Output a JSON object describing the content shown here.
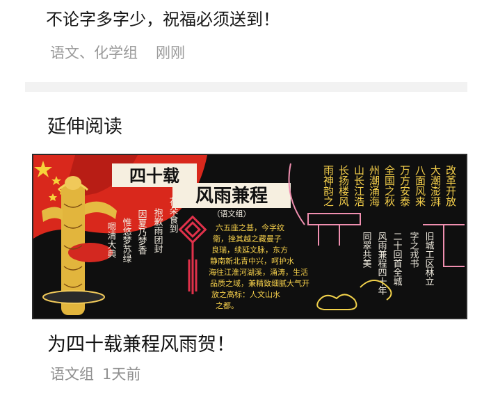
{
  "top_card": {
    "title": "不论字多字少，祝福必须送到！",
    "author": "语文、化学组",
    "time": "刚刚"
  },
  "section": {
    "heading": "延伸阅读"
  },
  "article": {
    "title": "为四十载兼程风雨贺！",
    "author": "语文组",
    "time": "1天前",
    "board": {
      "title_line1": "四十载",
      "title_line2": "风雨兼程",
      "group_label": "（语文组）",
      "poem_right": [
        "改革开放",
        "大潮澎湃",
        "八面风来",
        "万方安泰",
        "全国之秋",
        "州潮涌海",
        "山长江浩",
        "长扬楼风",
        "雨神韵之"
      ],
      "colors": {
        "board": "#101010",
        "flag_red": "#d9281c",
        "chalk_yellow": "#f2d24b",
        "chalk_pink": "#f08fb0",
        "chalk_white": "#f1ece0"
      }
    }
  }
}
